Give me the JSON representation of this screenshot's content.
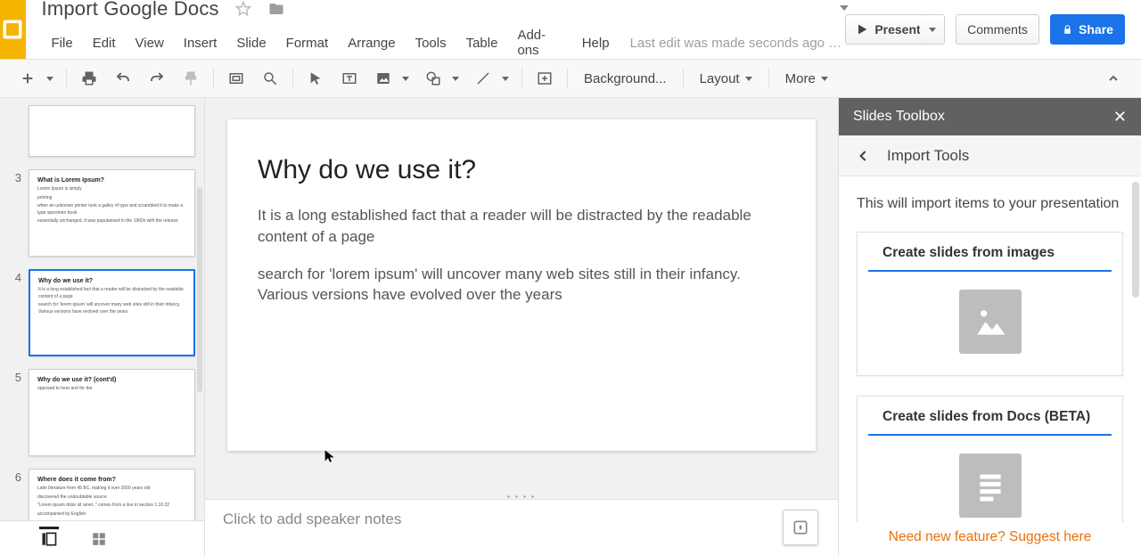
{
  "header": {
    "doc_title": "Import Google Docs",
    "menu": [
      "File",
      "Edit",
      "View",
      "Insert",
      "Slide",
      "Format",
      "Arrange",
      "Tools",
      "Table",
      "Add-ons",
      "Help"
    ],
    "last_edit": "Last edit was made seconds ago by D…",
    "present": "Present",
    "comments": "Comments",
    "share": "Share"
  },
  "toolbar": {
    "background": "Background...",
    "layout": "Layout",
    "more": "More"
  },
  "filmstrip": {
    "slides": [
      {
        "num": "",
        "title": "",
        "lines": [],
        "peek": true
      },
      {
        "num": "3",
        "title": "What is Lorem Ipsum?",
        "lines": [
          "Lorem Ipsum is simply",
          "printing",
          "when an unknown printer took a galley of type and scrambled it to make a type specimen book",
          "essentially unchanged. It was popularised in the 1960s with the release"
        ]
      },
      {
        "num": "4",
        "title": "Why do we use it?",
        "lines": [
          "It is a long established fact that a reader will be distracted by the readable content of a page",
          "search for 'lorem ipsum' will uncover many web sites still in their infancy. Various versions have evolved over the years"
        ],
        "selected": true
      },
      {
        "num": "5",
        "title": "Why do we use it? (cont'd)",
        "lines": [
          "opposed to here and for the"
        ]
      },
      {
        "num": "6",
        "title": "Where does it come from?",
        "lines": [
          "Latin literature from 45 BC, making it over 2000 years old",
          "discovered the undoubtable source",
          "\"Lorem ipsum dolor sit amet..\" comes from a line in section 1.10.32",
          "accompanied by English"
        ]
      }
    ]
  },
  "slide": {
    "title": "Why do we use it?",
    "p1": "It is a long established fact that a reader will be distracted by the readable content of a page",
    "p2": "search for 'lorem ipsum' will uncover many web sites still in their infancy. Various versions have evolved over the years"
  },
  "notes_placeholder": "Click to add speaker notes",
  "sidebar": {
    "title": "Slides Toolbox",
    "subtitle": "Import Tools",
    "intro": "This will import items to your presentation",
    "card1": "Create slides from images",
    "card2": "Create slides from Docs (BETA)",
    "suggest": "Need new feature? Suggest here"
  }
}
